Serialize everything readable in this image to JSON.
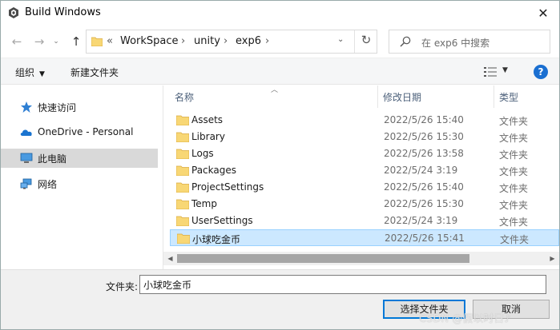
{
  "window": {
    "title": "Build Windows",
    "close_glyph": "✕"
  },
  "nav": {
    "back": "←",
    "forward": "→",
    "up": "↑",
    "refresh": "↻"
  },
  "address": {
    "overflow": "«",
    "segments": [
      "WorkSpace",
      "unity",
      "exp6"
    ],
    "chevron": "›",
    "dropdown": "⌄"
  },
  "search": {
    "placeholder": "在 exp6 中搜索"
  },
  "toolbar": {
    "organize": "组织",
    "new_folder": "新建文件夹",
    "help": "?",
    "caret": "▼"
  },
  "sidebar": {
    "items": [
      {
        "label": "快速访问",
        "icon": "star-icon"
      },
      {
        "label": "OneDrive - Personal",
        "icon": "cloud-icon"
      },
      {
        "label": "此电脑",
        "icon": "computer-icon"
      },
      {
        "label": "网络",
        "icon": "network-icon"
      }
    ],
    "selected_index": 2
  },
  "columns": {
    "name": "名称",
    "modified": "修改日期",
    "type": "类型"
  },
  "files": [
    {
      "name": "Assets",
      "modified": "2022/5/26 15:40",
      "type": "文件夹"
    },
    {
      "name": "Library",
      "modified": "2022/5/26 15:30",
      "type": "文件夹"
    },
    {
      "name": "Logs",
      "modified": "2022/5/26 13:58",
      "type": "文件夹"
    },
    {
      "name": "Packages",
      "modified": "2022/5/24 3:19",
      "type": "文件夹"
    },
    {
      "name": "ProjectSettings",
      "modified": "2022/5/26 15:40",
      "type": "文件夹"
    },
    {
      "name": "Temp",
      "modified": "2022/5/26 15:30",
      "type": "文件夹"
    },
    {
      "name": "UserSettings",
      "modified": "2022/5/24 3:19",
      "type": "文件夹"
    },
    {
      "name": "小球吃金币",
      "modified": "2022/5/26 15:41",
      "type": "文件夹"
    }
  ],
  "selected_file_index": 7,
  "filename": {
    "label": "文件夹:",
    "value": "小球吃金币"
  },
  "buttons": {
    "select": "选择文件夹",
    "cancel": "取消"
  },
  "watermark": "CSDN @假以时日♪",
  "colors": {
    "accent": "#0078d7",
    "selection": "#cce8ff",
    "folder": "#f8d775"
  }
}
